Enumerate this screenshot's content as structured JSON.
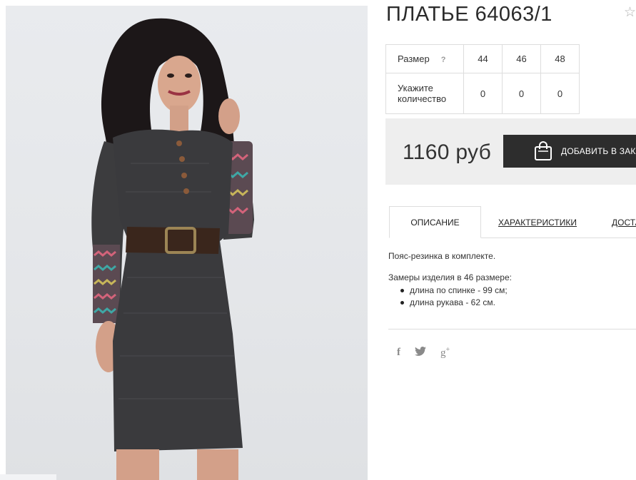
{
  "product": {
    "title": "ПЛАТЬЕ 64063/1",
    "favorite_icon": "star-icon"
  },
  "sizes": {
    "size_label": "Размер",
    "help_label": "?",
    "qty_label_line1": "Укажите",
    "qty_label_line2": "количество",
    "items": [
      {
        "size": "44",
        "qty": "0"
      },
      {
        "size": "46",
        "qty": "0"
      },
      {
        "size": "48",
        "qty": "0"
      }
    ]
  },
  "price": {
    "value": "1160 руб",
    "add_to_cart_label": "ДОБАВИТЬ В ЗАКАЗ"
  },
  "tabs": [
    {
      "label": "ОПИСАНИЕ",
      "active": true
    },
    {
      "label": "ХАРАКТЕРИСТИКИ",
      "active": false
    },
    {
      "label": "ДОСТАВКА",
      "active": false
    }
  ],
  "description": {
    "line1": "Пояс-резинка в комплекте.",
    "line2": "Замеры изделия в 46 размере:",
    "bullets": [
      "длина по спинке - 99 см;",
      "длина рукава - 62 см."
    ]
  },
  "social": {
    "facebook": "f",
    "twitter_icon": "twitter-icon",
    "google": "g"
  },
  "colors": {
    "button_bg": "#2d2d2d",
    "price_bg": "#eeeeee",
    "border": "#dddddd",
    "icon_gray": "#8a8a8a"
  }
}
